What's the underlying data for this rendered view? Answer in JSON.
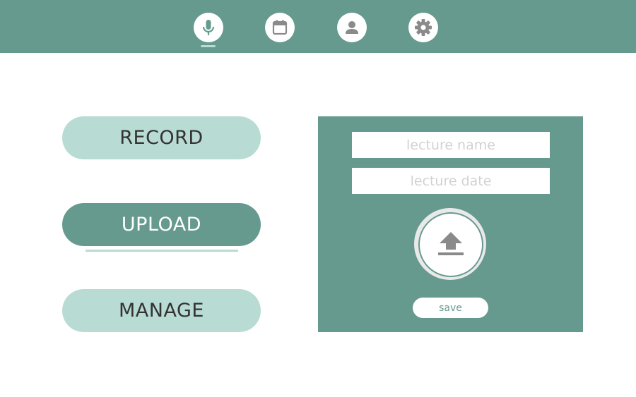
{
  "nav": {
    "items": [
      {
        "icon": "microphone-icon",
        "active": true
      },
      {
        "icon": "calendar-icon",
        "active": false
      },
      {
        "icon": "user-icon",
        "active": false
      },
      {
        "icon": "gear-icon",
        "active": false
      }
    ]
  },
  "menu": {
    "record_label": "RECORD",
    "upload_label": "UPLOAD",
    "manage_label": "MANAGE",
    "active": "UPLOAD"
  },
  "upload_panel": {
    "lecture_name_placeholder": "lecture name",
    "lecture_name_value": "",
    "lecture_date_placeholder": "lecture date",
    "lecture_date_value": "",
    "upload_icon": "upload-arrow-icon",
    "save_label": "save"
  },
  "colors": {
    "primary": "#669a8f",
    "light": "#b8dbd4",
    "icon_gray": "#8a8a8a",
    "placeholder": "#d2d2d2"
  }
}
